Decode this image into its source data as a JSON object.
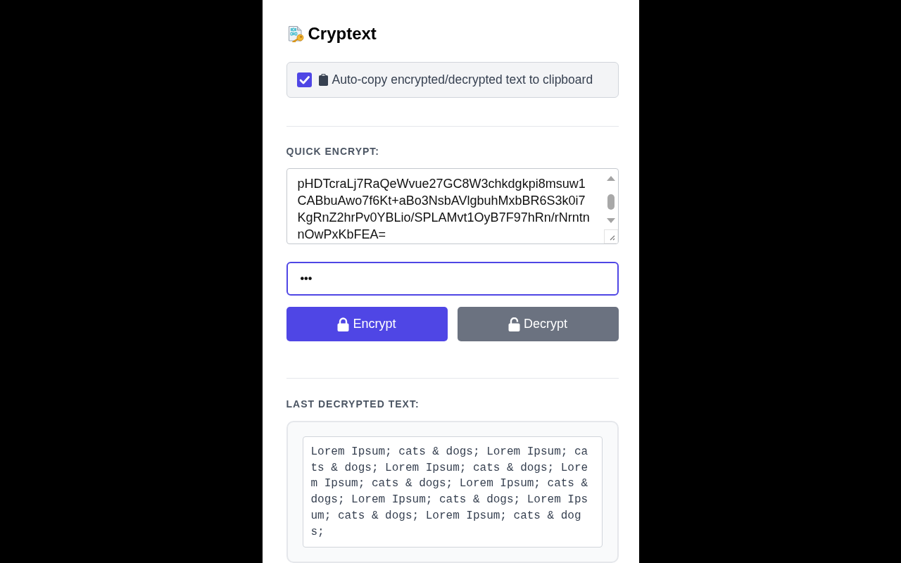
{
  "header": {
    "title": "Cryptext"
  },
  "auto_copy": {
    "label": "Auto-copy encrypted/decrypted text to clipboard",
    "checked": true
  },
  "quick_encrypt": {
    "label": "QUICK ENCRYPT:",
    "ciphertext_lines": [
      "pHDTcraLj7RaQeWvue27GC8W3chkdgkpi8msuw1",
      "CABbuAwo7f6Kt+aBo3NsbAVlgbuhMxbBR6S3k0i7",
      "KgRnZ2hrPv0YBLio/SPLAMvt1OyB7F97hRn/rNrntn",
      "nOwPxKbFEA="
    ],
    "password": {
      "value": "•••"
    },
    "buttons": [
      {
        "label": "Encrypt",
        "kind": "encrypt"
      },
      {
        "label": "Decrypt",
        "kind": "decrypt"
      }
    ]
  },
  "last_decrypted": {
    "label": "LAST DECRYPTED TEXT:",
    "text": "Lorem Ipsum; cats & dogs; Lorem Ipsum; cats & dogs; Lorem Ipsum; cats & dogs; Lorem Ipsum; cats & dogs; Lorem Ipsum; cats & dogs; Lorem Ipsum; cats & dogs; Lorem Ipsum; cats & dogs; Lorem Ipsum; cats & dogs;"
  }
}
